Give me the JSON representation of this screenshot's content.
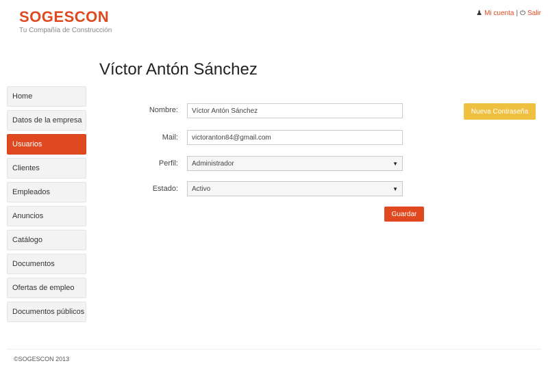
{
  "brand": {
    "name": "SOGESCON",
    "tagline": "Tu Compañía de Construcción"
  },
  "toplinks": {
    "account": "Mi cuenta",
    "separator": "|",
    "logout": "Salir"
  },
  "page": {
    "title": "Víctor Antón Sánchez"
  },
  "sidebar": {
    "items": [
      {
        "label": "Home"
      },
      {
        "label": "Datos de la empresa"
      },
      {
        "label": "Usuarios",
        "active": true
      },
      {
        "label": "Clientes"
      },
      {
        "label": "Empleados"
      },
      {
        "label": "Anuncios"
      },
      {
        "label": "Catálogo"
      },
      {
        "label": "Documentos"
      },
      {
        "label": "Ofertas de empleo"
      },
      {
        "label": "Documentos públicos"
      }
    ]
  },
  "form": {
    "nombre": {
      "label": "Nombre:",
      "value": "Víctor Antón Sánchez"
    },
    "mail": {
      "label": "Mail:",
      "value": "victoranton84@gmail.com"
    },
    "perfil": {
      "label": "Perfil:",
      "value": "Administrador"
    },
    "estado": {
      "label": "Estado:",
      "value": "Activo"
    },
    "save_label": "Guardar",
    "new_password_label": "Nueva Contraseña"
  },
  "footer": {
    "copyright": "©SOGESCON 2013"
  },
  "colors": {
    "accent": "#e0491f",
    "warning": "#f0c040"
  },
  "icons": {
    "account": "user-icon",
    "logout": "power-icon",
    "select": "caret-down-icon"
  }
}
